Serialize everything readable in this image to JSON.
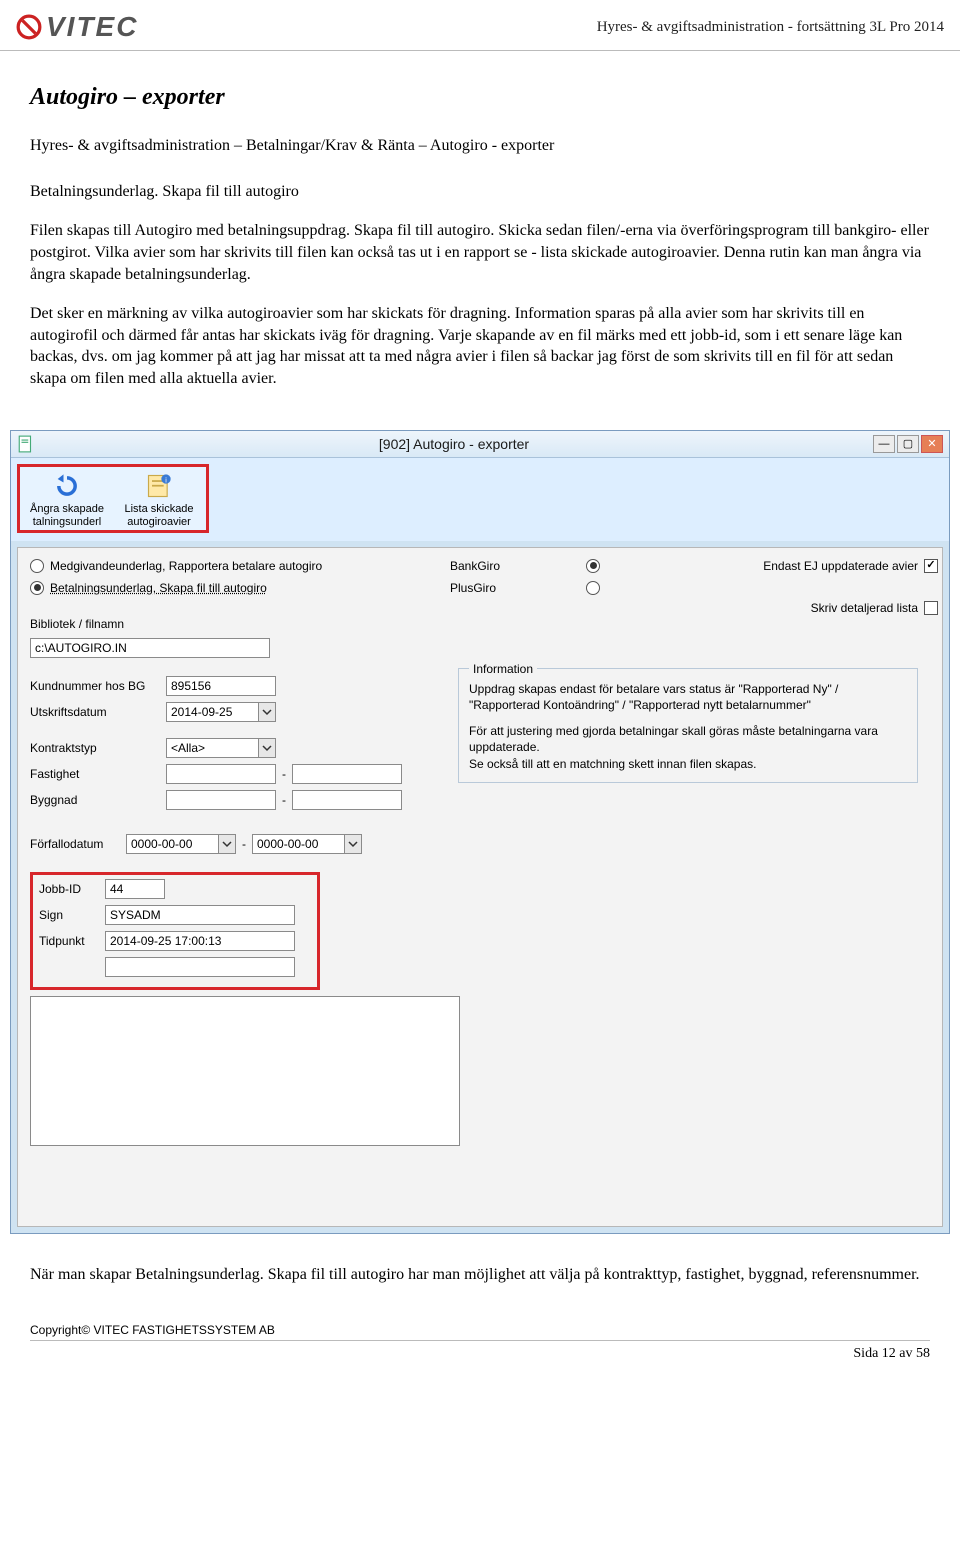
{
  "header": {
    "logo_text": "VITEC",
    "doc_title": "Hyres- & avgiftsadministration - fortsättning 3L Pro 2014"
  },
  "section_title": "Autogiro – exporter",
  "breadcrumb": "Hyres- & avgiftsadministration – Betalningar/Krav & Ränta – Autogiro - exporter",
  "para1": "Betalningsunderlag. Skapa fil till autogiro",
  "para2": "Filen skapas till Autogiro med betalningsuppdrag. Skapa fil till autogiro. Skicka sedan filen/-erna via överföringsprogram till bankgiro- eller postgirot. Vilka avier som har skrivits till filen kan också tas ut i en rapport se - lista skickade autogiroavier. Denna rutin kan man ångra via ångra skapade betalningsunderlag.",
  "para3": "Det sker en märkning av vilka autogiroavier som har skickats för dragning. Information sparas på alla avier som har skrivits till en autogirofil och därmed får antas har skickats iväg för dragning. Varje skapande av en fil märks med ett jobb-id, som i ett senare läge kan backas, dvs. om jag kommer på att jag har missat att ta med några avier i filen så backar jag först de som skrivits till en fil för att sedan skapa om filen med alla aktuella avier.",
  "window": {
    "title": "[902]  Autogiro - exporter",
    "toolbar": {
      "undo": "Ångra skapade talningsunderl",
      "list": "Lista skickade autogiroavier"
    },
    "radios": {
      "opt1": "Medgivandeunderlag, Rapportera betalare autogiro",
      "opt2": "Betalningsunderlag, Skapa fil till autogiro",
      "bankgiro": "BankGiro",
      "plusgiro": "PlusGiro"
    },
    "right": {
      "only_unupdated": "Endast EJ uppdaterade avier",
      "detailed_list": "Skriv detaljerad lista"
    },
    "filepath_label": "Bibliotek / filnamn",
    "filepath_value": "c:\\AUTOGIRO.IN",
    "kund_label": "Kundnummer hos BG",
    "kund_value": "895156",
    "utskrift_label": "Utskriftsdatum",
    "utskrift_value": "2014-09-25",
    "kontrakt_label": "Kontraktstyp",
    "kontrakt_value": "<Alla>",
    "fastighet_label": "Fastighet",
    "byggnad_label": "Byggnad",
    "forfall_label": "Förfallodatum",
    "forfall_from": "0000-00-00",
    "forfall_to": "0000-00-00",
    "info_title": "Information",
    "info_body1": "Uppdrag skapas endast för betalare vars status är \"Rapporterad Ny\" / \"Rapporterad Kontoändring\" / \"Rapporterad nytt betalarnummer\"",
    "info_body2": "För att justering med gjorda betalningar skall göras måste betalningarna vara uppdaterade.\nSe också till att en matchning skett innan filen skapas.",
    "job": {
      "jobid_label": "Jobb-ID",
      "jobid_value": "44",
      "sign_label": "Sign",
      "sign_value": "SYSADM",
      "tidpunkt_label": "Tidpunkt",
      "tidpunkt_value": "2014-09-25 17:00:13"
    }
  },
  "footer_para": "När man skapar Betalningsunderlag. Skapa fil till autogiro har man möjlighet att välja på kontrakttyp, fastighet, byggnad, referensnummer.",
  "copyright_prefix": "Copyright© ",
  "copyright_company": "VITEC FASTIGHETSSYSTEM AB",
  "page_number": "Sida 12 av 58"
}
